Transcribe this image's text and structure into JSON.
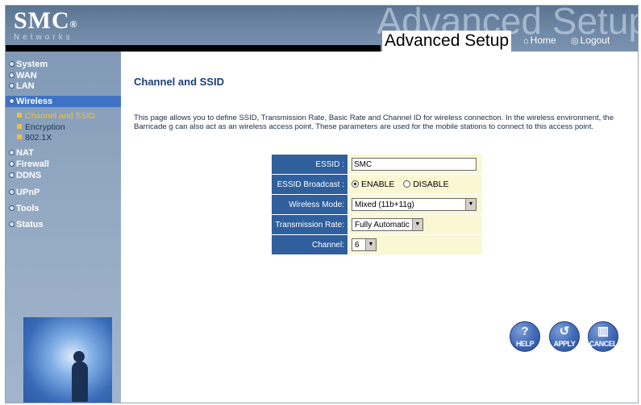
{
  "header": {
    "brand": "SMC",
    "reg_mark": "®",
    "brand_sub": "Networks",
    "ghost_title": "Advanced Setup",
    "title": "Advanced Setup",
    "home_label": "Home",
    "logout_label": "Logout"
  },
  "sidebar": {
    "items": [
      {
        "label": "System"
      },
      {
        "label": "WAN"
      },
      {
        "label": "LAN"
      },
      {
        "label": "Wireless"
      },
      {
        "label": "NAT"
      },
      {
        "label": "Firewall"
      },
      {
        "label": "DDNS"
      },
      {
        "label": "UPnP"
      },
      {
        "label": "Tools"
      },
      {
        "label": "Status"
      }
    ],
    "sub_items": [
      {
        "label": "Channel and SSID"
      },
      {
        "label": "Encryption"
      },
      {
        "label": "802.1X"
      }
    ]
  },
  "main": {
    "title": "Channel and SSID",
    "description": "This page allows you to define SSID, Transmission Rate, Basic Rate and Channel ID for wireless connection.  In the wireless environment, the Barricade g can also act as an wireless access point.  These parameters are used for the mobile stations to connect to this access point.",
    "form": {
      "essid_label": "ESSID :",
      "essid_value": "SMC",
      "broadcast_label": "ESSID Broadcast :",
      "broadcast_enable": "ENABLE",
      "broadcast_disable": "DISABLE",
      "broadcast_selected": "ENABLE",
      "mode_label": "Wireless Mode:",
      "mode_value": "Mixed (11b+11g)",
      "rate_label": "Transmission Rate:",
      "rate_value": "Fully Automatic",
      "channel_label": "Channel:",
      "channel_value": "6"
    },
    "buttons": {
      "help": "HELP",
      "apply": "APPLY",
      "cancel": "CANCEL"
    }
  },
  "colors": {
    "label_cell": "#2f5f9c",
    "value_cell": "#fcf7d3",
    "active_nav": "#3f72c4",
    "title_text": "#1b3f7a"
  }
}
